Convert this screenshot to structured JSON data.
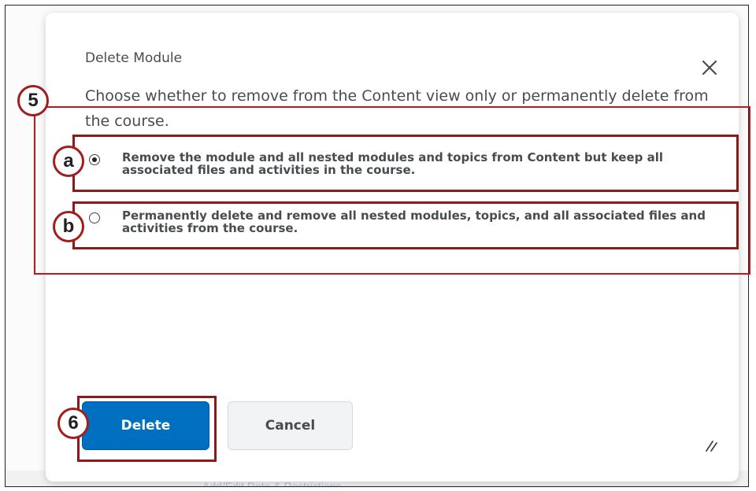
{
  "dialog": {
    "title": "Delete Module",
    "close_icon": "close-icon",
    "description": "Choose whether to remove from the Content view only or permanently delete from the course.",
    "options": [
      {
        "label": "Remove the module and all nested modules and topics from Content but keep all associated files and activities in the course.",
        "selected": true
      },
      {
        "label": "Permanently delete and remove all nested modules, topics, and all associated files and activities from the course.",
        "selected": false
      }
    ],
    "buttons": {
      "delete_label": "Delete",
      "cancel_label": "Cancel"
    },
    "resize_icon": "resize-handle-icon"
  },
  "annotations": {
    "step_5": "5",
    "option_a": "a",
    "option_b": "b",
    "step_6": "6"
  },
  "background": {
    "partial_text": "Add/Edit Date & Restrictions"
  },
  "colors": {
    "primary_button": "#006fbf",
    "annotation_red": "#c4161c",
    "text": "#494c4e"
  }
}
